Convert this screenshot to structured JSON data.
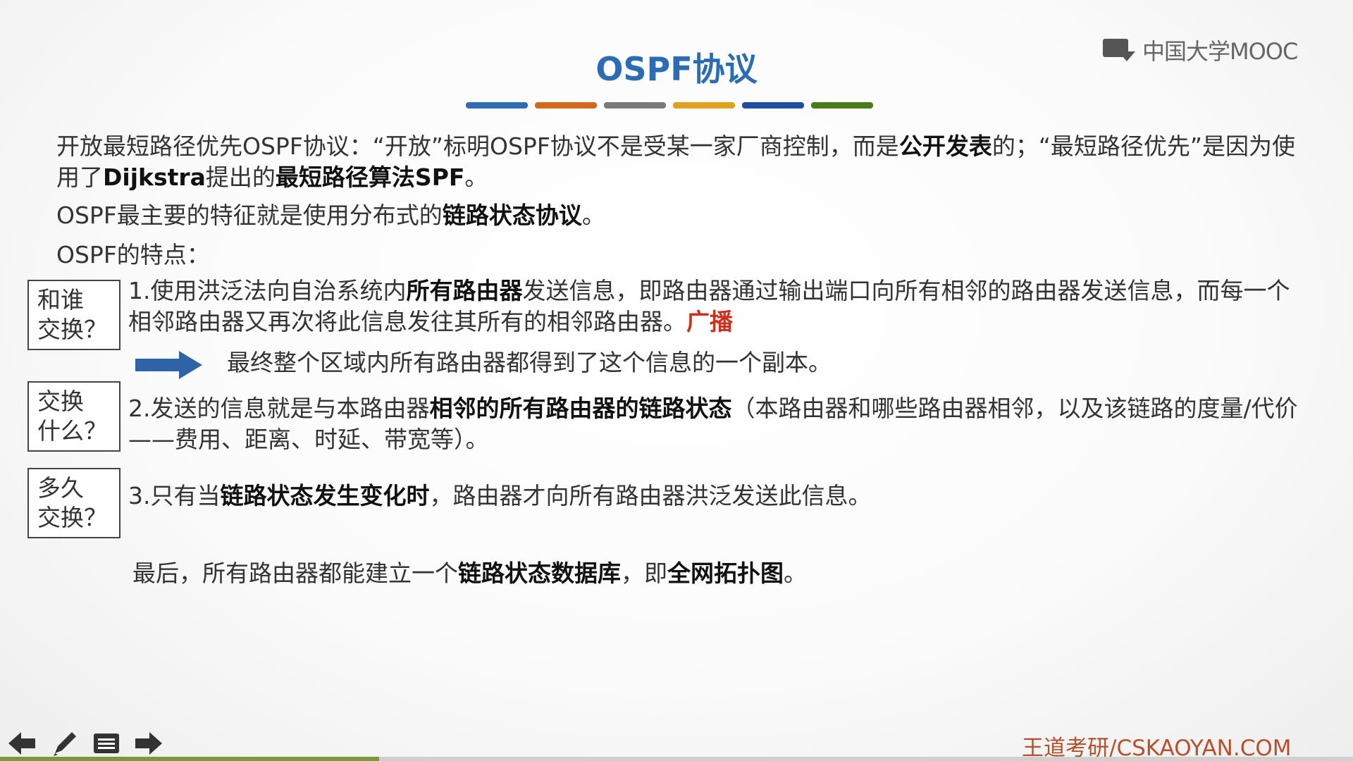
{
  "slide": {
    "title": "OSPF协议",
    "colorbar": [
      "#2f6db3",
      "#d2691e",
      "#7a7a7a",
      "#e0a21c",
      "#1f4f9c",
      "#4a7a1a"
    ],
    "logo_text": "中国大学MOOC",
    "para1": {
      "t1": "开放最短路径优先OSPF协议：“开放”标明OSPF协议不是受某一家厂商控制，而是",
      "b1": "公开发表",
      "t2": "的；“最短路径优先”是因为使用了",
      "b2": "Dijkstra",
      "t3": "提出的",
      "b3": "最短路径算法SPF",
      "t4": "。"
    },
    "para2": {
      "t1": "OSPF最主要的特征就是使用分布式的",
      "b1": "链路状态协议",
      "t2": "。"
    },
    "para3": "OSPF的特点：",
    "boxes": [
      {
        "line1": "和谁",
        "line2": "交换？"
      },
      {
        "line1": "交换",
        "line2": "什么？"
      },
      {
        "line1": "多久",
        "line2": "交换？"
      }
    ],
    "item1": {
      "t1": "1.使用洪泛法向自治系统内",
      "b1": "所有路由器",
      "t2": "发送信息，即路由器通过输出端口向所有相邻的路由器发送信息，而每一个相邻路由器又再次将此信息发往其所有的相邻路由器。",
      "red": "广播"
    },
    "arrow_text": "最终整个区域内所有路由器都得到了这个信息的一个副本。",
    "item2": {
      "t1": "2.发送的信息就是与本路由器",
      "b1": "相邻的所有路由器的链路状态",
      "t2": "（本路由器和哪些路由器相邻，以及该链路的度量/代价——费用、距离、时延、带宽等）。"
    },
    "item3": {
      "t1": "3.只有当",
      "b1": "链路状态发生变化时",
      "t2": "，路由器才向所有路由器洪泛发送此信息。"
    },
    "final": {
      "t1": "最后，所有路由器都能建立一个",
      "b1": "链路状态数据库",
      "t2": "，即",
      "b2": "全网拓扑图",
      "t3": "。"
    },
    "footer": "王道考研/CSKAOYAN.COM",
    "progress": 0.28
  }
}
